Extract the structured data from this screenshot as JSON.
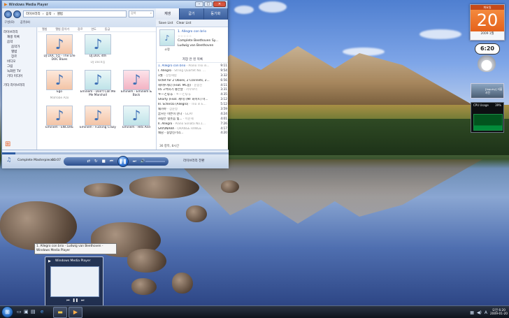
{
  "wmp": {
    "title": "Windows Media Player",
    "breadcrumb": [
      "라이브러리",
      "음악",
      "앨범"
    ],
    "search_placeholder": "검색",
    "menu": [
      "구성(O)",
      "공유(H)",
      "앨범",
      "앨범 음악가",
      "장르",
      "연도",
      "등급"
    ],
    "tabs": [
      "재생",
      "굽기",
      "동기화"
    ],
    "save_list": "Save List",
    "clear_list": "Clear List",
    "sidebar": [
      {
        "label": "라이브러리",
        "level": 0
      },
      {
        "label": "재생 목록",
        "level": 1
      },
      {
        "label": "음악",
        "level": 1
      },
      {
        "label": "음악가",
        "level": 2
      },
      {
        "label": "앨범",
        "level": 2
      },
      {
        "label": "장르",
        "level": 2
      },
      {
        "label": "비디오",
        "level": 1
      },
      {
        "label": "그림",
        "level": 1
      },
      {
        "label": "녹화된 TV",
        "level": 1
      },
      {
        "label": "기타 미디어",
        "level": 1
      },
      {
        "label": "기타 라이브러리",
        "level": 0
      }
    ],
    "column_headers": [
      "앨범",
      "앨범 음악가",
      "장르",
      "연도",
      "등급"
    ],
    "albums": [
      {
        "title": "DJ DOC 5집 - The Life DOC Blues",
        "artist": "",
        "style": "peach"
      },
      {
        "title": "DJ.DOC 4th",
        "artist": "DJ Doc4집",
        "style": "teal"
      },
      {
        "title": "",
        "artist": "",
        "style": ""
      },
      {
        "title": "Ego",
        "artist": "Mafrobe Azo",
        "style": "peach"
      },
      {
        "title": "Eminem - Don't Call Me Me Marshall",
        "artist": "",
        "style": "teal"
      },
      {
        "title": "Eminem - Eminem & Back",
        "artist": "",
        "style": "pink"
      },
      {
        "title": "Eminem - ENCORE",
        "artist": "",
        "style": "peach"
      },
      {
        "title": "Eminem - Fucking Crazy",
        "artist": "",
        "style": "peach"
      },
      {
        "title": "Eminem - Hits And",
        "artist": "",
        "style": "teal"
      }
    ],
    "now_playing": {
      "title": "1. Allegro con brio",
      "rating": "☆☆☆☆☆",
      "album": "Complete Beethoven Sy...",
      "artist": "Ludwig van Beethoven",
      "art_caption": "쇼팽"
    },
    "playlist_header": "저장 안 된 목록",
    "playlist": [
      {
        "name": "1. Allegro con brio",
        "artist": " - Piano Trio in...",
        "duration": "9:11",
        "selected": true
      },
      {
        "name": "I. Allegro",
        "artist": " - String Quartet No. ...",
        "duration": "9:54",
        "selected": false
      },
      {
        "name": "1월",
        "artist": " - 장일해팝",
        "duration": "3:32",
        "selected": false
      },
      {
        "name": "Octet for 2 Oboes, 2 Clarinets, 2...",
        "artist": "",
        "duration": "6:56",
        "selected": false
      },
      {
        "name": "해피투게더 (Feat. MC몽)",
        "artist": " - 윤종신",
        "duration": "4:11",
        "selected": false
      },
      {
        "name": "05 고백하기 좋은날",
        "artist": " - 카우보이",
        "duration": "3:31",
        "selected": false
      },
      {
        "name": "キーとなる",
        "artist": " - キーとなる",
        "duration": "4:35",
        "selected": false
      },
      {
        "name": "Shorty (Feat. 제이) (Mr 화이트) 마...",
        "artist": "",
        "duration": "3:12",
        "selected": false
      },
      {
        "name": "III. Scherzo (Allegro)",
        "artist": " - Trio in E...",
        "duration": "5:12",
        "selected": false
      },
      {
        "name": "왜가야",
        "artist": " - 장윤정",
        "duration": "3:59",
        "selected": false
      },
      {
        "name": "꿈꾸는 어른이 만나",
        "artist": " - GLAY",
        "duration": "4:24",
        "selected": false
      },
      {
        "name": "사랑은 헛웃음 빛...",
        "artist": " - 이문세",
        "duration": "4:01",
        "selected": false
      },
      {
        "name": "II. Allegro",
        "artist": " - Piano Sonata No.1...",
        "duration": "7:26",
        "selected": false
      },
      {
        "name": "SAYONARA",
        "artist": " - ORANGE RANGE",
        "duration": "4:17",
        "selected": false
      },
      {
        "name": "쾌남 - 동방신기의...",
        "artist": "",
        "duration": "4:20",
        "selected": false
      }
    ],
    "playlist_footer": "36 항목, 8시간",
    "controls": {
      "now_text": "Complete Masterpiece...",
      "elapsed": "00:07",
      "switch_label": "라이브러리 전환",
      "progress_fraction": 0.06
    }
  },
  "gadgets": {
    "calendar": {
      "weekday": "화요일",
      "day": "20",
      "year_month": "2009 1월"
    },
    "clock": {
      "time": "6:20"
    },
    "slideshow": {
      "caption": "[Inquiry] 서울 사진"
    },
    "cpu": {
      "label": "CPU Usage",
      "value": "39%"
    }
  },
  "taskbar": {
    "tooltip": "1. Allegro con brio - Ludwig van Beethoven - Windows Media Player",
    "thumbnail_title": "Windows Media Player",
    "time": "오전 6:20",
    "date": "2009-01-20"
  },
  "colors": {
    "accent": "#2f5da3",
    "calendar": "#e4621b",
    "close": "#d7563f"
  }
}
